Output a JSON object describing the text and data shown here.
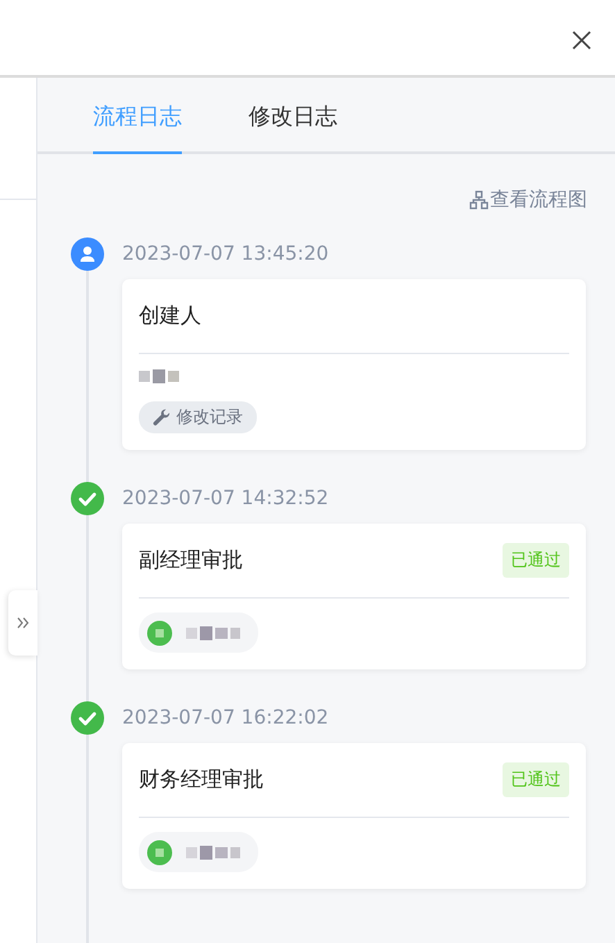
{
  "tabs": [
    {
      "label": "流程日志",
      "selected": true
    },
    {
      "label": "修改日志",
      "selected": false
    }
  ],
  "flow_chart_link": "查看流程图",
  "timeline": [
    {
      "kind": "creator",
      "time": "2023-07-07 13:45:20",
      "title": "创建人",
      "action": "修改记录"
    },
    {
      "kind": "approved",
      "time": "2023-07-07 14:32:52",
      "title": "副经理审批",
      "status": "已通过"
    },
    {
      "kind": "approved",
      "time": "2023-07-07 16:22:02",
      "title": "财务经理审批",
      "status": "已通过"
    }
  ]
}
